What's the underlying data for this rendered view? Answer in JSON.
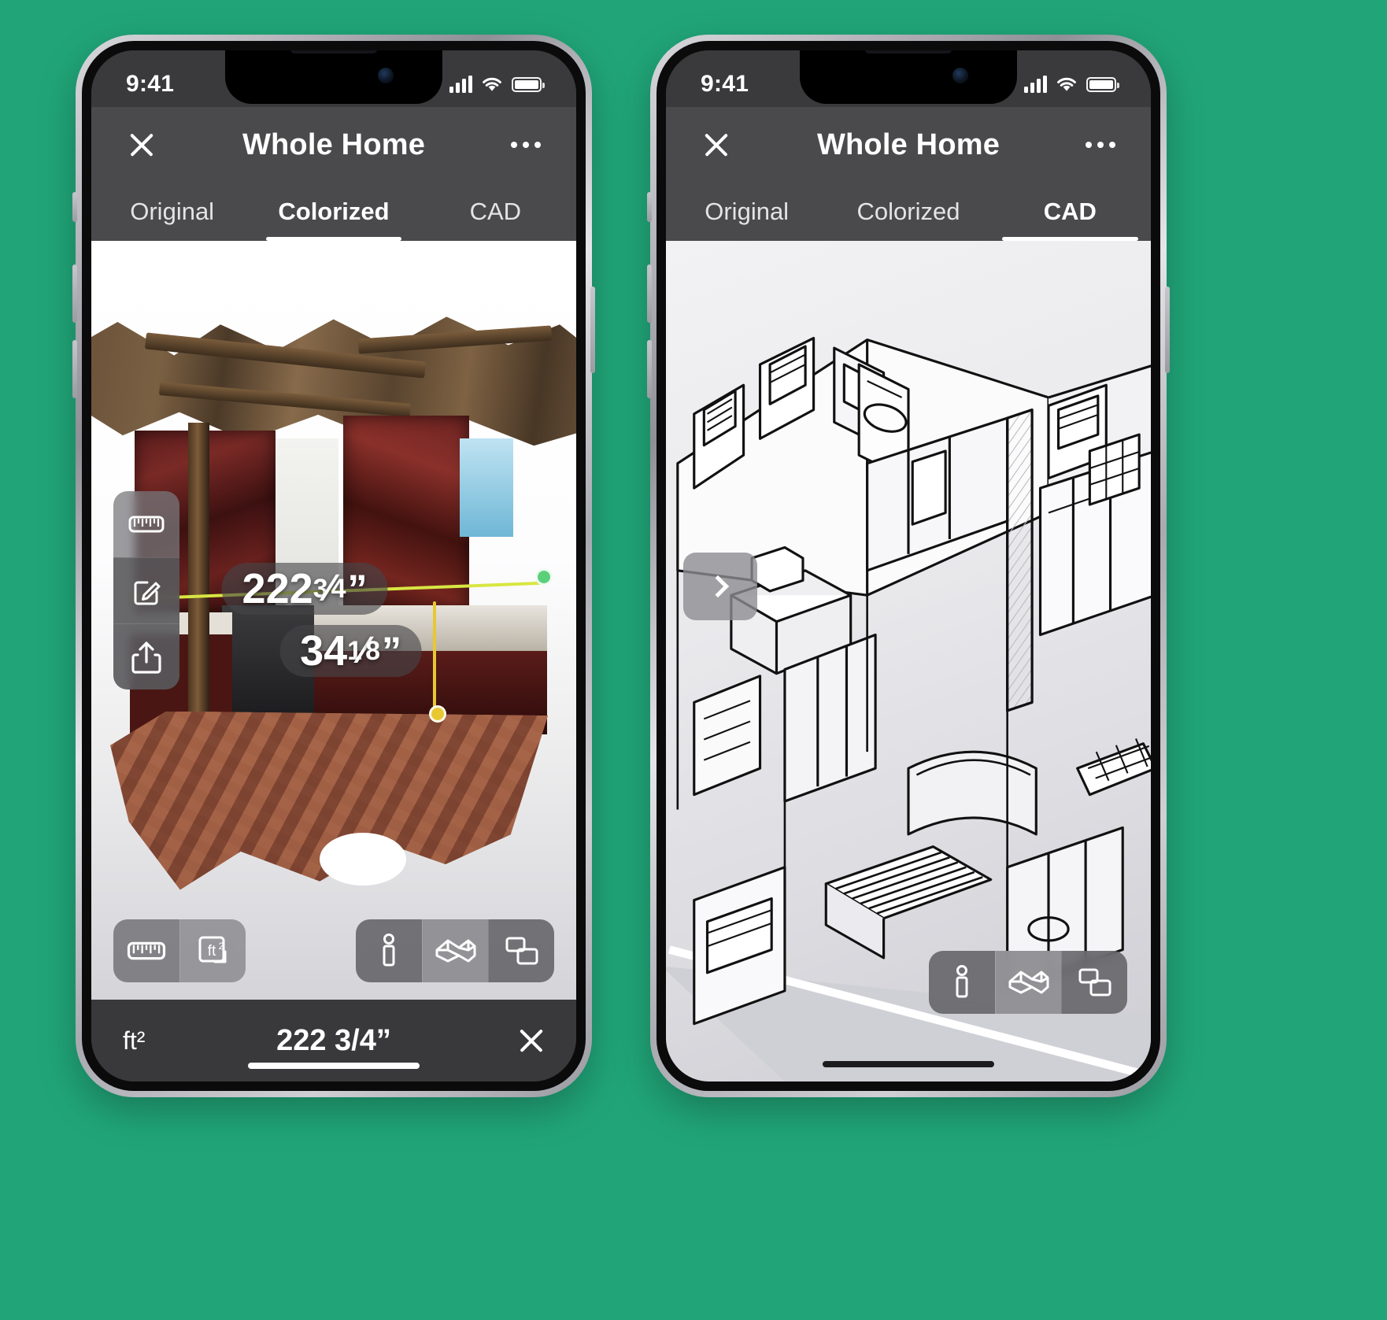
{
  "accent_background": "#21a578",
  "phones": [
    {
      "id": "left",
      "status": {
        "time": "9:41",
        "signal_icon": "cellular-bars-icon",
        "wifi_icon": "wifi-icon",
        "battery_icon": "battery-icon"
      },
      "nav": {
        "close_icon": "close-icon",
        "title": "Whole Home",
        "more_icon": "more-options-icon"
      },
      "tabs": [
        {
          "label": "Original",
          "active": false
        },
        {
          "label": "Colorized",
          "active": true
        },
        {
          "label": "CAD",
          "active": false
        }
      ],
      "measurements": [
        {
          "id": "horizontal",
          "whole": "222",
          "numerator": "3",
          "denominator": "4",
          "unit": "”",
          "line_color": "#d8e642",
          "endpoint_color": "#5bd07a"
        },
        {
          "id": "vertical",
          "whole": "34",
          "numerator": "1",
          "denominator": "8",
          "unit": "”",
          "line_color": "#e8c832"
        }
      ],
      "tool_column": [
        {
          "icon": "ruler-icon",
          "label": "Measure",
          "selected": false
        },
        {
          "icon": "edit-note-icon",
          "label": "Annotate",
          "selected": true
        },
        {
          "icon": "share-icon",
          "label": "Share",
          "selected": false
        }
      ],
      "bottom_left_segment": [
        {
          "icon": "ruler-icon",
          "label": "Measure tool",
          "selected": true
        },
        {
          "icon": "area-ft2-icon",
          "label": "ft²",
          "selected": false
        }
      ],
      "bottom_right_segment": [
        {
          "icon": "person-icon",
          "label": "First person view",
          "selected": false
        },
        {
          "icon": "dollhouse-3d-icon",
          "label": "Dollhouse view",
          "selected": true
        },
        {
          "icon": "floorplan-icon",
          "label": "Floor plan view",
          "selected": false
        }
      ],
      "measure_bar": {
        "unit": "ft²",
        "value": "222 3/4”",
        "close_icon": "close-icon"
      }
    },
    {
      "id": "right",
      "status": {
        "time": "9:41",
        "signal_icon": "cellular-bars-icon",
        "wifi_icon": "wifi-icon",
        "battery_icon": "battery-icon"
      },
      "nav": {
        "close_icon": "close-icon",
        "title": "Whole Home",
        "more_icon": "more-options-icon"
      },
      "tabs": [
        {
          "label": "Original",
          "active": false
        },
        {
          "label": "Colorized",
          "active": false
        },
        {
          "label": "CAD",
          "active": true
        }
      ],
      "expand_button": {
        "icon": "chevron-right-icon",
        "label": "Expand panel"
      },
      "bottom_right_segment": [
        {
          "icon": "person-icon",
          "label": "First person view",
          "selected": false
        },
        {
          "icon": "dollhouse-3d-icon",
          "label": "Dollhouse view",
          "selected": true
        },
        {
          "icon": "floorplan-icon",
          "label": "Floor plan view",
          "selected": false
        }
      ]
    }
  ]
}
